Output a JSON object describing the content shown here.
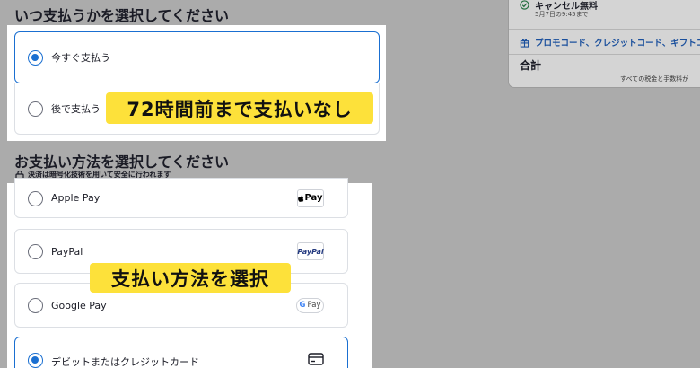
{
  "timing_section": {
    "title": "いつ支払うかを選択してください",
    "options": [
      {
        "label": "今すぐ支払う",
        "selected": true
      },
      {
        "label": "後で支払う",
        "selected": false
      }
    ],
    "callout": "72時間前まで支払いなし"
  },
  "payment_section": {
    "title": "お支払い方法を選択してください",
    "secure_note": "決済は暗号化技術を用いて安全に行われます",
    "options": [
      {
        "label": "Apple Pay",
        "badge": "Pay",
        "icon": "apple-icon",
        "selected": false
      },
      {
        "label": "PayPal",
        "badge": "PayPal",
        "selected": false
      },
      {
        "label": "Google Pay",
        "badge": "Pay",
        "badge_prefix": "G",
        "selected": false
      },
      {
        "label": "デビットまたはクレジットカード",
        "icon": "credit-card-icon",
        "selected": true
      }
    ],
    "callout": "支払い方法を選択"
  },
  "summary": {
    "cancel_title": "キャンセル無料",
    "cancel_sub": "5月7日の9:45まで",
    "promo_link": "プロモコード、クレジットコード、ギフトコ",
    "total_label": "合計",
    "tax_note": "すべての税金と手数料が"
  },
  "colors": {
    "accent": "#1a6fd1",
    "highlight": "#fde13a",
    "paypal_blue": "#253b80",
    "paypal_light": "#179bd7"
  }
}
